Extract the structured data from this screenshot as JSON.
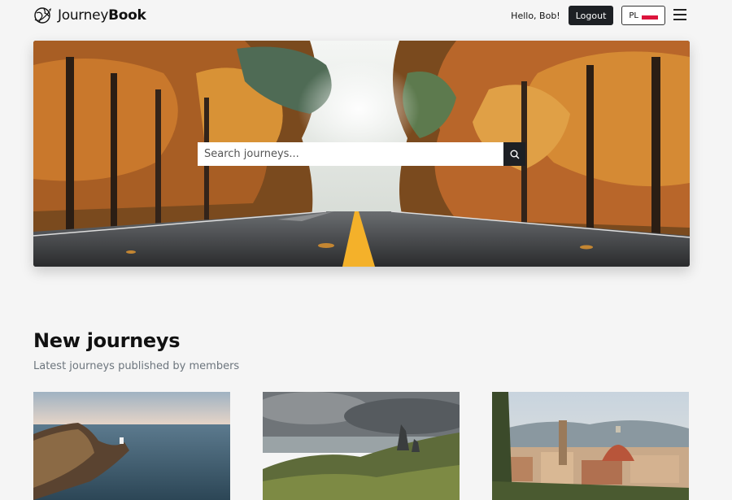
{
  "brand": {
    "name_light": "Journey",
    "name_bold": "Book",
    "logo_icon": "globe-icon"
  },
  "nav": {
    "greeting": "Hello, Bob!",
    "logout_label": "Logout",
    "language_code": "PL",
    "flag_colors": [
      "#ffffff",
      "#dc143c"
    ],
    "menu_icon": "hamburger-icon"
  },
  "hero": {
    "search_placeholder": "Search journeys...",
    "search_icon": "search-icon"
  },
  "section": {
    "title": "New journeys",
    "subtitle": "Latest journeys published by members"
  },
  "cards": [
    {
      "image": "coastal-lighthouse-cliff-photo"
    },
    {
      "image": "rocky-highlands-stormy-sky-photo"
    },
    {
      "image": "florence-cathedral-cityscape-photo"
    }
  ],
  "colors": {
    "dark_button": "#1d2024",
    "background": "#f5f5f5",
    "muted_text": "#6c757d"
  }
}
